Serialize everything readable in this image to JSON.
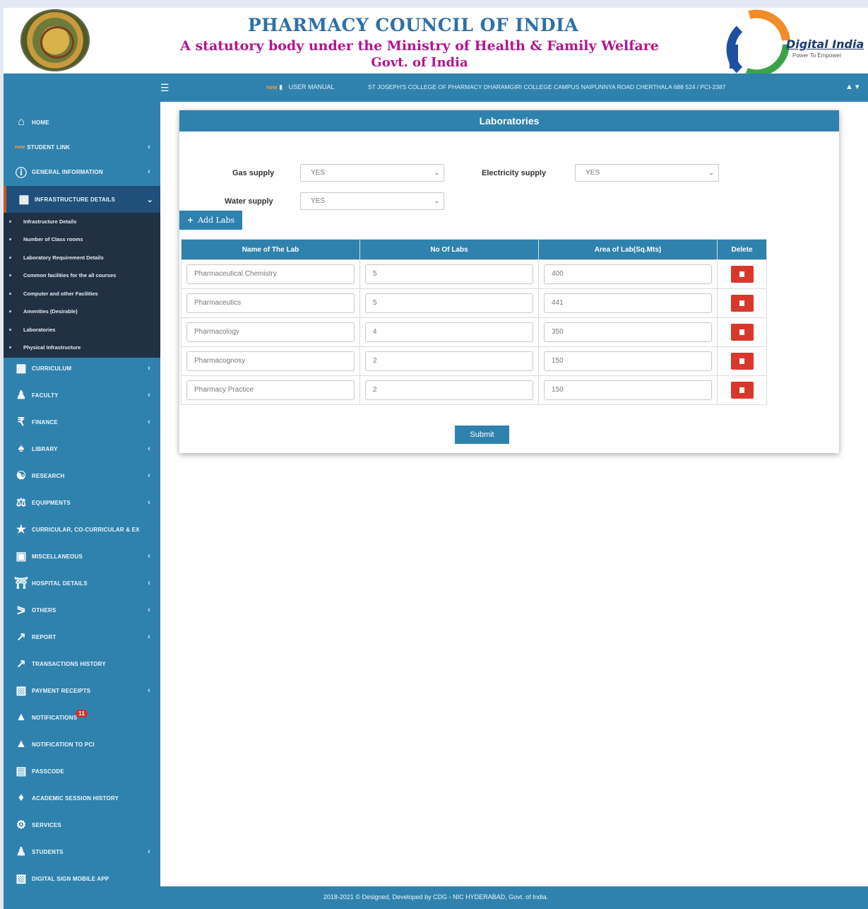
{
  "header": {
    "title": "PHARMACY COUNCIL OF INDIA",
    "subtitle": "A statutory body under the Ministry of Health & Family Welfare",
    "subtitle2": "Govt. of India",
    "digital_india": "Digital India",
    "digital_india_tagline": "Power To Empower"
  },
  "topbar": {
    "new_tag": "new",
    "user_manual": "USER MANUAL",
    "college": "ST JOSEPH'S COLLEGE OF PHARMACY DHARAMGIRI COLLEGE CAMPUS NAIPUNNYA ROAD CHERTHALA 688 524 / PCI-2387"
  },
  "sidebar": {
    "items": [
      {
        "label": "HOME",
        "icon": "home-icon"
      },
      {
        "label": "STUDENT LINK",
        "icon": "new-tag",
        "new": "new"
      },
      {
        "label": "GENERAL INFORMATION",
        "icon": "info-icon"
      },
      {
        "label": "INFRASTRUCTURE DETAILS",
        "icon": "building-icon"
      },
      {
        "label": "CURRICULUM",
        "icon": "curriculum-icon"
      },
      {
        "label": "FACULTY",
        "icon": "faculty-icon"
      },
      {
        "label": "FINANCE",
        "icon": "rupee-icon"
      },
      {
        "label": "LIBRARY",
        "icon": "library-icon"
      },
      {
        "label": "RESEARCH",
        "icon": "research-icon"
      },
      {
        "label": "EQUIPMENTS",
        "icon": "flask-icon"
      },
      {
        "label": "CURRICULAR, CO-CURRICULAR & EX",
        "icon": "trophy-icon"
      },
      {
        "label": "MISCELLANEOUS",
        "icon": "misc-icon"
      },
      {
        "label": "HOSPITAL DETAILS",
        "icon": "hospital-icon"
      },
      {
        "label": "OTHERS",
        "icon": "share-icon"
      },
      {
        "label": "REPORT",
        "icon": "chart-icon"
      },
      {
        "label": "TRANSACTIONS HISTORY",
        "icon": "chart-icon"
      },
      {
        "label": "PAYMENT RECEIPTS",
        "icon": "receipt-icon"
      },
      {
        "label": "NOTIFICATIONS",
        "icon": "bell-icon",
        "badge": "11"
      },
      {
        "label": "NOTIFICATION TO PCI",
        "icon": "bell-icon"
      },
      {
        "label": "PASSCODE",
        "icon": "passcode-icon"
      },
      {
        "label": "ACADEMIC SESSION HISTORY",
        "icon": "puzzle-icon"
      },
      {
        "label": "SERVICES",
        "icon": "services-icon"
      },
      {
        "label": "STUDENTS",
        "icon": "student-icon"
      },
      {
        "label": "DIGITAL SIGN MOBILE APP",
        "icon": "app-icon"
      }
    ],
    "submenu": [
      "Infrastructure Details",
      "Number of Class rooms",
      "Laboratory Requirement Details",
      "Common facilities for the all courses",
      "Computer and other Facilities",
      "Amenities (Desirable)",
      "Laboratories",
      "Physical Infrastructure"
    ]
  },
  "form": {
    "title": "Laboratories",
    "gas_label": "Gas supply",
    "gas_value": "YES",
    "electricity_label": "Electricity supply",
    "electricity_value": "YES",
    "water_label": "Water supply",
    "water_value": "YES",
    "add_labs": "Add Labs",
    "columns": [
      "Name of The Lab",
      "No Of Labs",
      "Area of Lab(Sq.Mts)",
      "Delete"
    ],
    "rows": [
      {
        "name": "Pharmaceutical Chemistry",
        "count": "5",
        "area": "400"
      },
      {
        "name": "Pharmaceutics",
        "count": "5",
        "area": "441"
      },
      {
        "name": "Pharmacology",
        "count": "4",
        "area": "350"
      },
      {
        "name": "Pharmacognosy",
        "count": "2",
        "area": "150"
      },
      {
        "name": "Pharmacy Practice",
        "count": "2",
        "area": "150"
      }
    ],
    "submit": "Submit"
  },
  "footer": {
    "text": "2018-2021 © Designed, Developed by CDG - NIC HYDERABAD, Govt. of India."
  },
  "colors": {
    "primary": "#2f82ad",
    "sidebar_dark": "#213042",
    "danger": "#d9372c",
    "title_blue": "#2e6fa7",
    "title_magenta": "#b3158f"
  }
}
